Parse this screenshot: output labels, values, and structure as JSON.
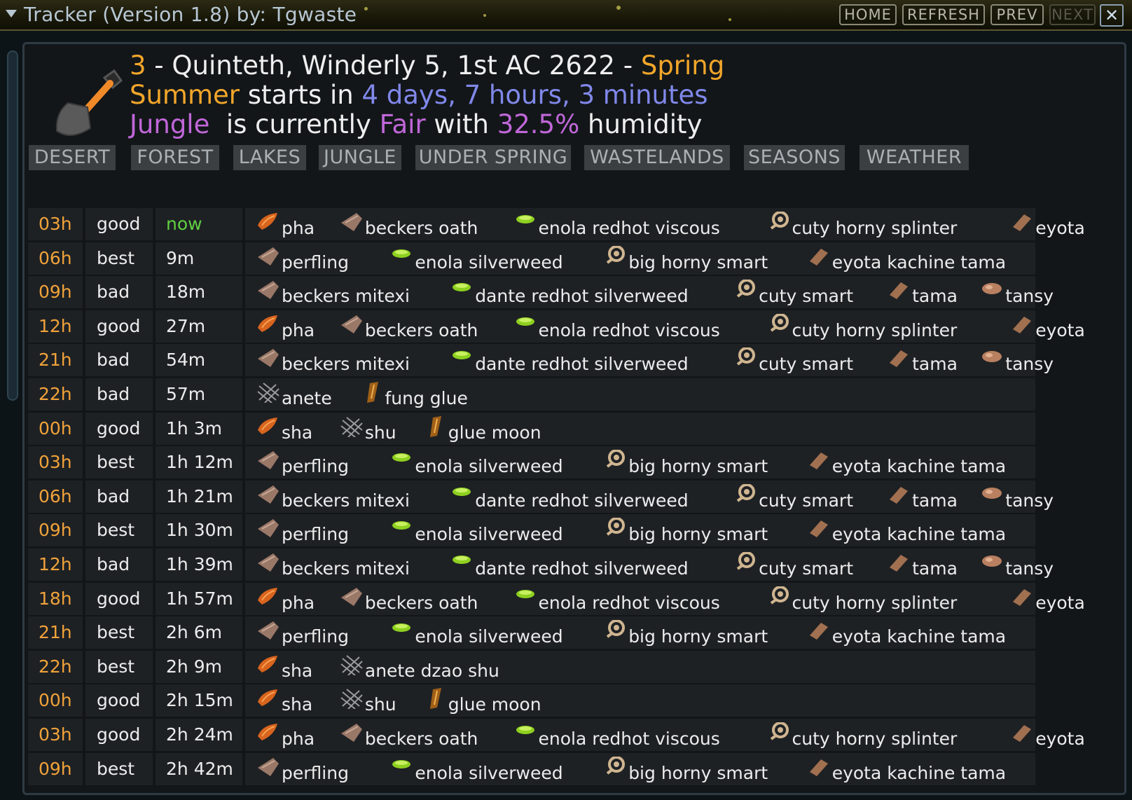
{
  "window": {
    "title": "Tracker (Version 1.8) by: Tgwaste",
    "buttons": [
      {
        "label": "HOME",
        "enabled": true
      },
      {
        "label": "REFRESH",
        "enabled": true
      },
      {
        "label": "PREV",
        "enabled": true
      },
      {
        "label": "NEXT",
        "enabled": false
      }
    ],
    "close_label": "✕"
  },
  "header": {
    "line1": {
      "number": "3",
      "date": " - Quinteth, Winderly 5, 1st AC 2622 - ",
      "season": "Spring"
    },
    "line2": {
      "season": "Summer",
      "mid": " starts in ",
      "countdown": "4 days, 7 hours, 3 minutes"
    },
    "line3": {
      "region": "Jungle",
      "mid1": "  is currently ",
      "weather": "Fair",
      "mid2": " with ",
      "humidity": "32.5%",
      "tail": " humidity"
    }
  },
  "tabs": [
    "DESERT",
    "FOREST",
    "LAKES",
    "JUNGLE",
    "UNDER SPRING",
    "WASTELANDS",
    "SEASONS",
    "WEATHER"
  ],
  "icon_colors": {
    "bark": "#d8641e",
    "wood": "#9a7868",
    "goo": "#8ed020",
    "shell": "#cfb590",
    "seed": "#a07050",
    "node": "#b88060",
    "fiber": "#9a9aa0",
    "amber": "#a06018"
  },
  "rows": [
    {
      "hour": "03h",
      "quality": "good",
      "when": "now",
      "items": [
        {
          "name": "pha",
          "icon": "bark"
        },
        {
          "name": "beckers oath",
          "icon": "wood"
        },
        {
          "name": "enola redhot viscous",
          "icon": "goo"
        },
        {
          "name": "cuty horny splinter",
          "icon": "shell"
        },
        {
          "name": "eyota",
          "icon": "seed"
        }
      ]
    },
    {
      "hour": "06h",
      "quality": "best",
      "when": "9m",
      "items": [
        {
          "name": "perfling",
          "icon": "wood"
        },
        {
          "name": "enola silverweed",
          "icon": "goo"
        },
        {
          "name": "big horny smart",
          "icon": "shell"
        },
        {
          "name": "eyota kachine tama",
          "icon": "seed"
        }
      ]
    },
    {
      "hour": "09h",
      "quality": "bad",
      "when": "18m",
      "items": [
        {
          "name": "beckers mitexi",
          "icon": "wood"
        },
        {
          "name": "dante redhot silverweed",
          "icon": "goo"
        },
        {
          "name": "cuty smart",
          "icon": "shell"
        },
        {
          "name": "tama",
          "icon": "seed"
        },
        {
          "name": "tansy",
          "icon": "node"
        }
      ]
    },
    {
      "hour": "12h",
      "quality": "good",
      "when": "27m",
      "items": [
        {
          "name": "pha",
          "icon": "bark"
        },
        {
          "name": "beckers oath",
          "icon": "wood"
        },
        {
          "name": "enola redhot viscous",
          "icon": "goo"
        },
        {
          "name": "cuty horny splinter",
          "icon": "shell"
        },
        {
          "name": "eyota",
          "icon": "seed"
        }
      ]
    },
    {
      "hour": "21h",
      "quality": "bad",
      "when": "54m",
      "items": [
        {
          "name": "beckers mitexi",
          "icon": "wood"
        },
        {
          "name": "dante redhot silverweed",
          "icon": "goo"
        },
        {
          "name": "cuty smart",
          "icon": "shell"
        },
        {
          "name": "tama",
          "icon": "seed"
        },
        {
          "name": "tansy",
          "icon": "node"
        }
      ]
    },
    {
      "hour": "22h",
      "quality": "bad",
      "when": "57m",
      "items": [
        {
          "name": "anete",
          "icon": "fiber"
        },
        {
          "name": "fung glue",
          "icon": "amber"
        }
      ]
    },
    {
      "hour": "00h",
      "quality": "good",
      "when": "1h 3m",
      "items": [
        {
          "name": "sha",
          "icon": "bark"
        },
        {
          "name": "shu",
          "icon": "fiber"
        },
        {
          "name": "glue moon",
          "icon": "amber"
        }
      ]
    },
    {
      "hour": "03h",
      "quality": "best",
      "when": "1h 12m",
      "items": [
        {
          "name": "perfling",
          "icon": "wood"
        },
        {
          "name": "enola silverweed",
          "icon": "goo"
        },
        {
          "name": "big horny smart",
          "icon": "shell"
        },
        {
          "name": "eyota kachine tama",
          "icon": "seed"
        }
      ]
    },
    {
      "hour": "06h",
      "quality": "bad",
      "when": "1h 21m",
      "items": [
        {
          "name": "beckers mitexi",
          "icon": "wood"
        },
        {
          "name": "dante redhot silverweed",
          "icon": "goo"
        },
        {
          "name": "cuty smart",
          "icon": "shell"
        },
        {
          "name": "tama",
          "icon": "seed"
        },
        {
          "name": "tansy",
          "icon": "node"
        }
      ]
    },
    {
      "hour": "09h",
      "quality": "best",
      "when": "1h 30m",
      "items": [
        {
          "name": "perfling",
          "icon": "wood"
        },
        {
          "name": "enola silverweed",
          "icon": "goo"
        },
        {
          "name": "big horny smart",
          "icon": "shell"
        },
        {
          "name": "eyota kachine tama",
          "icon": "seed"
        }
      ]
    },
    {
      "hour": "12h",
      "quality": "bad",
      "when": "1h 39m",
      "items": [
        {
          "name": "beckers mitexi",
          "icon": "wood"
        },
        {
          "name": "dante redhot silverweed",
          "icon": "goo"
        },
        {
          "name": "cuty smart",
          "icon": "shell"
        },
        {
          "name": "tama",
          "icon": "seed"
        },
        {
          "name": "tansy",
          "icon": "node"
        }
      ]
    },
    {
      "hour": "18h",
      "quality": "good",
      "when": "1h 57m",
      "items": [
        {
          "name": "pha",
          "icon": "bark"
        },
        {
          "name": "beckers oath",
          "icon": "wood"
        },
        {
          "name": "enola redhot viscous",
          "icon": "goo"
        },
        {
          "name": "cuty horny splinter",
          "icon": "shell"
        },
        {
          "name": "eyota",
          "icon": "seed"
        }
      ]
    },
    {
      "hour": "21h",
      "quality": "best",
      "when": "2h 6m",
      "items": [
        {
          "name": "perfling",
          "icon": "wood"
        },
        {
          "name": "enola silverweed",
          "icon": "goo"
        },
        {
          "name": "big horny smart",
          "icon": "shell"
        },
        {
          "name": "eyota kachine tama",
          "icon": "seed"
        }
      ]
    },
    {
      "hour": "22h",
      "quality": "best",
      "when": "2h 9m",
      "items": [
        {
          "name": "sha",
          "icon": "bark"
        },
        {
          "name": "anete dzao shu",
          "icon": "fiber"
        }
      ]
    },
    {
      "hour": "00h",
      "quality": "good",
      "when": "2h 15m",
      "items": [
        {
          "name": "sha",
          "icon": "bark"
        },
        {
          "name": "shu",
          "icon": "fiber"
        },
        {
          "name": "glue moon",
          "icon": "amber"
        }
      ]
    },
    {
      "hour": "03h",
      "quality": "good",
      "when": "2h 24m",
      "items": [
        {
          "name": "pha",
          "icon": "bark"
        },
        {
          "name": "beckers oath",
          "icon": "wood"
        },
        {
          "name": "enola redhot viscous",
          "icon": "goo"
        },
        {
          "name": "cuty horny splinter",
          "icon": "shell"
        },
        {
          "name": "eyota",
          "icon": "seed"
        }
      ]
    },
    {
      "hour": "09h",
      "quality": "best",
      "when": "2h 42m",
      "items": [
        {
          "name": "perfling",
          "icon": "wood"
        },
        {
          "name": "enola silverweed",
          "icon": "goo"
        },
        {
          "name": "big horny smart",
          "icon": "shell"
        },
        {
          "name": "eyota kachine tama",
          "icon": "seed"
        }
      ]
    }
  ]
}
